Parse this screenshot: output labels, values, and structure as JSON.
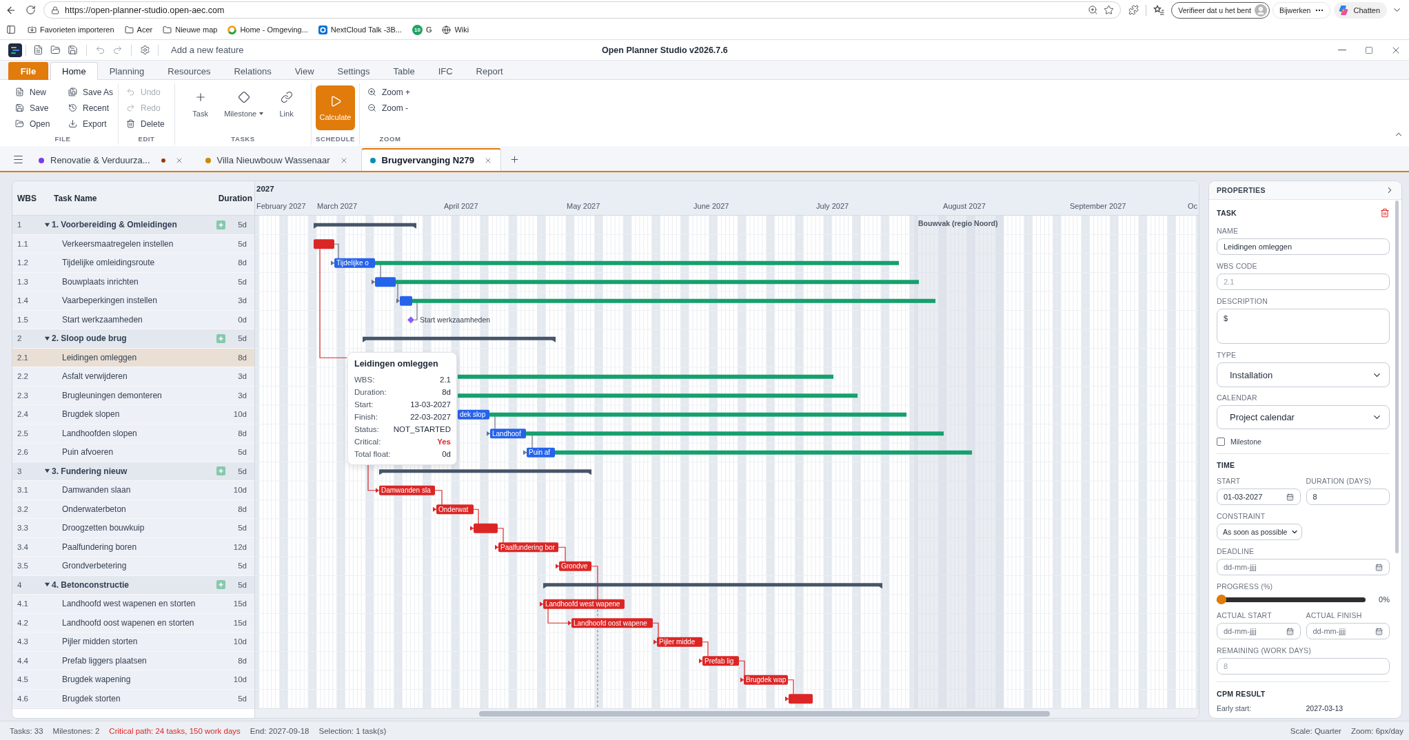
{
  "browser": {
    "url": "https://open-planner-studio.open-aec.com",
    "bookmarks": [
      {
        "label": "Favorieten importeren",
        "kind": "import"
      },
      {
        "label": "Acer",
        "kind": "folder"
      },
      {
        "label": "Nieuwe map",
        "kind": "folder"
      },
      {
        "label": "Home - Omgeving...",
        "kind": "site"
      },
      {
        "label": "NextCloud Talk -3B...",
        "kind": "chat"
      },
      {
        "label": "G",
        "kind": "counter",
        "badge": "10"
      },
      {
        "label": "Wiki",
        "kind": "wiki"
      }
    ],
    "profile_button": "Verifieer dat u het bent",
    "update_button": "Bijwerken",
    "chat_button": "Chatten"
  },
  "app": {
    "feature_prompt": "Add a new feature",
    "title": "Open Planner Studio v2026.7.6"
  },
  "ribbon": {
    "tabs": [
      {
        "label": "File",
        "kind": "file",
        "selected": false
      },
      {
        "label": "Home",
        "kind": "tab",
        "selected": true
      },
      {
        "label": "Planning",
        "kind": "tab",
        "selected": false
      },
      {
        "label": "Resources",
        "kind": "tab",
        "selected": false
      },
      {
        "label": "Relations",
        "kind": "tab",
        "selected": false
      },
      {
        "label": "View",
        "kind": "tab",
        "selected": false
      },
      {
        "label": "Settings",
        "kind": "tab",
        "selected": false
      },
      {
        "label": "Table",
        "kind": "tab",
        "selected": false
      },
      {
        "label": "IFC",
        "kind": "tab",
        "selected": false
      },
      {
        "label": "Report",
        "kind": "tab",
        "selected": false
      }
    ],
    "groups": [
      {
        "label": "FILE",
        "kind": "list",
        "items": [
          {
            "label": "New"
          },
          {
            "label": "Save"
          },
          {
            "label": "Open"
          },
          {
            "label": "Save As"
          },
          {
            "label": "Recent"
          },
          {
            "label": "Export"
          }
        ]
      },
      {
        "label": "EDIT",
        "kind": "list",
        "items": [
          {
            "label": "Undo",
            "disabled": true
          },
          {
            "label": "Redo",
            "disabled": true
          },
          {
            "label": "Delete",
            "disabled": false
          }
        ]
      },
      {
        "label": "TASKS",
        "kind": "large",
        "items": [
          {
            "label": "Task",
            "has_menu": false
          },
          {
            "label": "Milestone",
            "has_menu": true
          },
          {
            "label": "Link",
            "has_menu": false
          }
        ]
      },
      {
        "label": "SCHEDULE",
        "kind": "primary",
        "items": [
          {
            "label": "Calculate"
          }
        ]
      },
      {
        "label": "ZOOM",
        "kind": "list",
        "items": [
          {
            "label": "Zoom +"
          },
          {
            "label": "Zoom -"
          }
        ]
      }
    ]
  },
  "doc_tabs": [
    {
      "label": "Renovatie & Verduurza...",
      "color": "#7c3aed",
      "modified": true,
      "selected": false
    },
    {
      "label": "Villa Nieuwbouw Wassenaar",
      "color": "#ca8a04",
      "modified": false,
      "selected": false
    },
    {
      "label": "Brugvervanging N279",
      "color": "#0891b2",
      "modified": false,
      "selected": true
    }
  ],
  "task_table": {
    "columns": [
      "WBS",
      "Task Name",
      "Duration"
    ],
    "tasks": [
      {
        "wbs": "1",
        "name": "1. Voorbereiding & Omleidingen",
        "duration": "5d",
        "kind": "summary",
        "expanded": true,
        "selected": false,
        "children": [
          {
            "wbs": "1.1",
            "name": "Verkeersmaatregelen instellen",
            "duration": "5d",
            "kind": "task",
            "selected": false,
            "float": false,
            "bar": {
              "critical": true
            }
          },
          {
            "wbs": "1.2",
            "name": "Tijdelijke omleidingsroute",
            "duration": "8d",
            "kind": "task",
            "selected": false,
            "float": true,
            "bar": {
              "critical": false,
              "label": "Tijdelijke o"
            }
          },
          {
            "wbs": "1.3",
            "name": "Bouwplaats inrichten",
            "duration": "5d",
            "kind": "task",
            "selected": false,
            "float": true,
            "bar": {
              "critical": false
            }
          },
          {
            "wbs": "1.4",
            "name": "Vaarbeperkingen instellen",
            "duration": "3d",
            "kind": "task",
            "selected": false,
            "float": true,
            "bar": {
              "critical": false
            }
          },
          {
            "wbs": "1.5",
            "name": "Start werkzaamheden",
            "duration": "0d",
            "kind": "milestone",
            "selected": false,
            "bar": {
              "critical": false,
              "label": "Start werkzaamheden"
            }
          }
        ]
      },
      {
        "wbs": "2",
        "name": "2. Sloop oude brug",
        "duration": "5d",
        "kind": "summary",
        "expanded": true,
        "selected": false,
        "children": [
          {
            "wbs": "2.1",
            "name": "Leidingen omleggen",
            "duration": "8d",
            "kind": "task",
            "selected": true,
            "float": false
          },
          {
            "wbs": "2.2",
            "name": "Asfalt verwijderen",
            "duration": "3d",
            "kind": "task",
            "selected": false,
            "float": true
          },
          {
            "wbs": "2.3",
            "name": "Brugleuningen demonteren",
            "duration": "3d",
            "kind": "task",
            "selected": false,
            "float": true
          },
          {
            "wbs": "2.4",
            "name": "Brugdek slopen",
            "duration": "10d",
            "kind": "task",
            "selected": false,
            "float": true,
            "bar": {
              "critical": false,
              "label": "dek slop"
            }
          },
          {
            "wbs": "2.5",
            "name": "Landhoofden slopen",
            "duration": "8d",
            "kind": "task",
            "selected": false,
            "float": true,
            "bar": {
              "critical": false,
              "label": "Landhoof"
            }
          },
          {
            "wbs": "2.6",
            "name": "Puin afvoeren",
            "duration": "5d",
            "kind": "task",
            "selected": false,
            "float": true,
            "bar": {
              "critical": false,
              "label": "Puin af"
            }
          }
        ]
      },
      {
        "wbs": "3",
        "name": "3. Fundering nieuw",
        "duration": "5d",
        "kind": "summary",
        "expanded": true,
        "selected": false,
        "children": [
          {
            "wbs": "3.1",
            "name": "Damwanden slaan",
            "duration": "10d",
            "kind": "task",
            "selected": false,
            "float": false,
            "bar": {
              "critical": true,
              "label": "Damwanden sla"
            }
          },
          {
            "wbs": "3.2",
            "name": "Onderwaterbeton",
            "duration": "8d",
            "kind": "task",
            "selected": false,
            "float": false,
            "bar": {
              "critical": true,
              "label": "Onderwat"
            }
          },
          {
            "wbs": "3.3",
            "name": "Droogzetten bouwkuip",
            "duration": "5d",
            "kind": "task",
            "selected": false,
            "float": false,
            "bar": {
              "critical": true
            }
          },
          {
            "wbs": "3.4",
            "name": "Paalfundering boren",
            "duration": "12d",
            "kind": "task",
            "selected": false,
            "float": false,
            "bar": {
              "critical": true,
              "label": "Paalfundering bor"
            }
          },
          {
            "wbs": "3.5",
            "name": "Grondverbetering",
            "duration": "5d",
            "kind": "task",
            "selected": false,
            "float": false,
            "bar": {
              "critical": true,
              "label": "Grondve"
            }
          }
        ]
      },
      {
        "wbs": "4",
        "name": "4. Betonconstructie",
        "duration": "5d",
        "kind": "summary",
        "expanded": true,
        "selected": false,
        "children": [
          {
            "wbs": "4.1",
            "name": "Landhoofd west wapenen en storten",
            "duration": "15d",
            "kind": "task",
            "selected": false,
            "float": false,
            "bar": {
              "critical": true,
              "label": "Landhoofd west wapene"
            }
          },
          {
            "wbs": "4.2",
            "name": "Landhoofd oost wapenen en storten",
            "duration": "15d",
            "kind": "task",
            "selected": false,
            "float": false,
            "bar": {
              "critical": true,
              "label": "Landhoofd oost wapene"
            }
          },
          {
            "wbs": "4.3",
            "name": "Pijler midden storten",
            "duration": "10d",
            "kind": "task",
            "selected": false,
            "float": false,
            "bar": {
              "critical": true,
              "label": "Pijler midde"
            }
          },
          {
            "wbs": "4.4",
            "name": "Prefab liggers plaatsen",
            "duration": "8d",
            "kind": "task",
            "selected": false,
            "float": false,
            "bar": {
              "critical": true,
              "label": "Prefab lig"
            }
          },
          {
            "wbs": "4.5",
            "name": "Brugdek wapening",
            "duration": "10d",
            "kind": "task",
            "selected": false,
            "float": false,
            "bar": {
              "critical": true,
              "label": "Brugdek wap"
            }
          },
          {
            "wbs": "4.6",
            "name": "Brugdek storten",
            "duration": "5d",
            "kind": "task",
            "selected": false,
            "float": false,
            "bar": {
              "critical": true
            }
          }
        ]
      }
    ]
  },
  "gantt": {
    "year": "2027",
    "months": [
      "February 2027",
      "March 2027",
      "April 2027",
      "May 2027",
      "June 2027",
      "July 2027",
      "August 2027",
      "September 2027",
      "Oc"
    ],
    "holiday": "Bouwvak (regio Noord)",
    "tooltip": {
      "title": "Leidingen omleggen",
      "rows": [
        {
          "label": "WBS:",
          "value": "2.1",
          "highlight": false
        },
        {
          "label": "Duration:",
          "value": "8d",
          "highlight": false
        },
        {
          "label": "Start:",
          "value": "13-03-2027",
          "highlight": false
        },
        {
          "label": "Finish:",
          "value": "22-03-2027",
          "highlight": false
        },
        {
          "label": "Status:",
          "value": "NOT_STARTED",
          "highlight": false
        },
        {
          "label": "Critical:",
          "value": "Yes",
          "highlight": true
        },
        {
          "label": "Total float:",
          "value": "0d",
          "highlight": false
        }
      ]
    }
  },
  "properties": {
    "title": "PROPERTIES",
    "task_heading": "TASK",
    "name": {
      "label": "NAME",
      "value": "Leidingen omleggen"
    },
    "wbs_code": {
      "label": "WBS CODE",
      "placeholder": "2.1"
    },
    "description": {
      "label": "DESCRIPTION",
      "value": "$"
    },
    "type": {
      "label": "TYPE",
      "value": "Installation"
    },
    "calendar": {
      "label": "CALENDAR",
      "value": "Project calendar"
    },
    "milestone": {
      "label": "Milestone",
      "checked": false
    },
    "time_heading": "TIME",
    "start": {
      "label": "START",
      "value": "01-03-2027"
    },
    "duration": {
      "label": "DURATION (DAYS)",
      "value": "8"
    },
    "constraint": {
      "label": "CONSTRAINT",
      "value": "As soon as possible"
    },
    "deadline": {
      "label": "DEADLINE",
      "placeholder": "dd-mm-jjjj"
    },
    "progress": {
      "label": "PROGRESS (%)",
      "level": 0,
      "reading": "0%"
    },
    "actual_start": {
      "label": "ACTUAL START",
      "placeholder": "dd-mm-jjjj"
    },
    "actual_finish": {
      "label": "ACTUAL FINISH",
      "placeholder": "dd-mm-jjjj"
    },
    "remaining": {
      "label": "REMAINING (WORK DAYS)",
      "placeholder": "8"
    },
    "cpm_heading": "CPM RESULT",
    "cpm_rows": [
      {
        "label": "Early start:",
        "value": "2027-03-13"
      }
    ]
  },
  "status_bar": {
    "items": [
      {
        "text": "Tasks: 33",
        "highlight": false
      },
      {
        "text": "Milestones: 2",
        "highlight": false
      },
      {
        "text": "Critical path: 24 tasks, 150 work days",
        "highlight": true
      },
      {
        "text": "End: 2027-09-18",
        "highlight": false
      },
      {
        "text": "Selection: 1 task(s)",
        "highlight": false
      }
    ],
    "right": [
      "Scale: Quarter",
      "Zoom: 6px/day"
    ]
  }
}
